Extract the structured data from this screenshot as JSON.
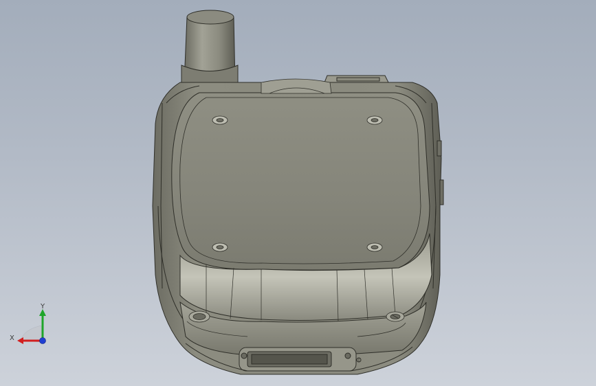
{
  "viewport": {
    "background_top": "#a3adbb",
    "background_bottom": "#cdd2da",
    "model": "handheld-radio-bottom-view"
  },
  "triad": {
    "x_label": "X",
    "y_label": "Y",
    "x_color": "#d21f1f",
    "y_color": "#1fa52a",
    "z_color": "#1f3fd2"
  },
  "model": {
    "body_color": "#8d8d80",
    "body_light": "#a8a89b",
    "body_dark": "#5f5f55",
    "edge_color": "#2e2e28"
  }
}
